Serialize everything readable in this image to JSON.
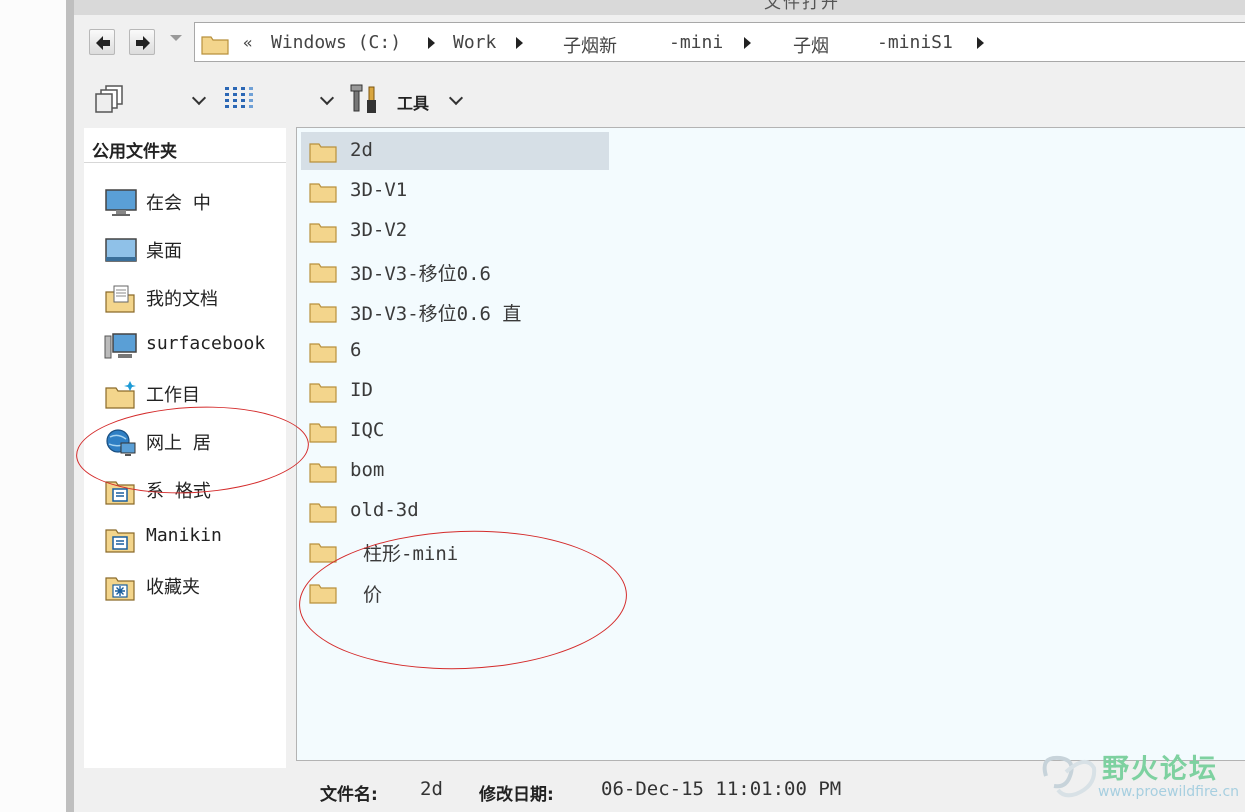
{
  "window": {
    "title": "文件打开"
  },
  "address_bar": {
    "overflow_glyph": "«",
    "crumbs": [
      "Windows (C:)",
      "Work",
      "子烟新",
      "-mini",
      "子烟",
      "-miniS1"
    ]
  },
  "toolbar": {
    "tools_label": "工具"
  },
  "sidebar": {
    "title": "公用文件夹",
    "items": [
      {
        "label": "在会  中",
        "icon": "monitor-icon"
      },
      {
        "label": "桌面",
        "icon": "desktop-icon"
      },
      {
        "label": "我的文档",
        "icon": "documents-icon"
      },
      {
        "label": "surfacebook",
        "icon": "computer-icon"
      },
      {
        "label": "工作目",
        "icon": "working-directory-icon"
      },
      {
        "label": "网上  居",
        "icon": "network-icon"
      },
      {
        "label": "系  格式",
        "icon": "system-format-icon"
      },
      {
        "label": "Manikin",
        "icon": "manikin-folder-icon"
      },
      {
        "label": "收藏夹",
        "icon": "favorites-icon"
      }
    ]
  },
  "files": [
    {
      "name": "2d",
      "selected": true
    },
    {
      "name": "3D-V1"
    },
    {
      "name": "3D-V2"
    },
    {
      "name": "3D-V3-移位0.6"
    },
    {
      "name": "3D-V3-移位0.6  直"
    },
    {
      "name": "6"
    },
    {
      "name": "ID"
    },
    {
      "name": "IQC"
    },
    {
      "name": "bom"
    },
    {
      "name": "old-3d"
    },
    {
      "name": " 柱形-mini"
    },
    {
      "name": " 价"
    }
  ],
  "status": {
    "filename_label": "文件名:",
    "filename_value": "2d",
    "modified_label": "修改日期:",
    "modified_value": "06-Dec-15 11:01:00 PM"
  },
  "watermark": {
    "title": "野火论坛",
    "url": "www.proewildfire.cn"
  },
  "colors": {
    "annotation": "#d42b2b",
    "file_pane_bg": "#f3fbfe",
    "selection": "#d6dfe6",
    "folder": "#f3d58c"
  }
}
